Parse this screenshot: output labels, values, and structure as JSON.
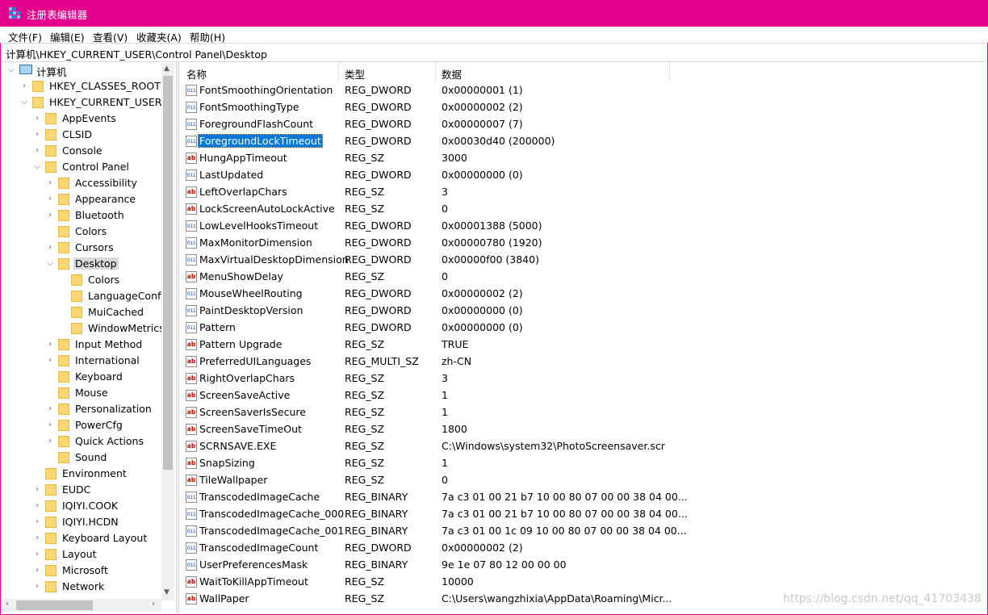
{
  "window": {
    "title": "注册表编辑器",
    "accent_color": "#e3008c"
  },
  "menu": [
    "文件(F)",
    "编辑(E)",
    "查看(V)",
    "收藏夹(A)",
    "帮助(H)"
  ],
  "address": "计算机\\HKEY_CURRENT_USER\\Control Panel\\Desktop",
  "tree": [
    {
      "label": "计算机",
      "depth": 0,
      "expanded": true,
      "icon": "computer-icon"
    },
    {
      "label": "HKEY_CLASSES_ROOT",
      "depth": 1,
      "expanded": false
    },
    {
      "label": "HKEY_CURRENT_USER",
      "depth": 1,
      "expanded": true
    },
    {
      "label": "AppEvents",
      "depth": 2,
      "expanded": false
    },
    {
      "label": "CLSID",
      "depth": 2,
      "expanded": false
    },
    {
      "label": "Console",
      "depth": 2,
      "expanded": false
    },
    {
      "label": "Control Panel",
      "depth": 2,
      "expanded": true
    },
    {
      "label": "Accessibility",
      "depth": 3,
      "expanded": false
    },
    {
      "label": "Appearance",
      "depth": 3,
      "expanded": false
    },
    {
      "label": "Bluetooth",
      "depth": 3,
      "expanded": false
    },
    {
      "label": "Colors",
      "depth": 3,
      "leaf": true
    },
    {
      "label": "Cursors",
      "depth": 3,
      "expanded": false
    },
    {
      "label": "Desktop",
      "depth": 3,
      "expanded": true,
      "selected": true
    },
    {
      "label": "Colors",
      "depth": 4,
      "leaf": true
    },
    {
      "label": "LanguageConfig",
      "depth": 4,
      "leaf": true
    },
    {
      "label": "MuiCached",
      "depth": 4,
      "leaf": true
    },
    {
      "label": "WindowMetrics",
      "depth": 4,
      "leaf": true
    },
    {
      "label": "Input Method",
      "depth": 3,
      "expanded": false
    },
    {
      "label": "International",
      "depth": 3,
      "expanded": false
    },
    {
      "label": "Keyboard",
      "depth": 3,
      "leaf": true
    },
    {
      "label": "Mouse",
      "depth": 3,
      "leaf": true
    },
    {
      "label": "Personalization",
      "depth": 3,
      "expanded": false
    },
    {
      "label": "PowerCfg",
      "depth": 3,
      "expanded": false
    },
    {
      "label": "Quick Actions",
      "depth": 3,
      "expanded": false
    },
    {
      "label": "Sound",
      "depth": 3,
      "leaf": true
    },
    {
      "label": "Environment",
      "depth": 2,
      "leaf": true
    },
    {
      "label": "EUDC",
      "depth": 2,
      "expanded": false
    },
    {
      "label": "IQIYI.COOK",
      "depth": 2,
      "expanded": false
    },
    {
      "label": "IQIYI.HCDN",
      "depth": 2,
      "expanded": false
    },
    {
      "label": "Keyboard Layout",
      "depth": 2,
      "expanded": false
    },
    {
      "label": "Layout",
      "depth": 2,
      "expanded": false
    },
    {
      "label": "Microsoft",
      "depth": 2,
      "expanded": false
    },
    {
      "label": "Network",
      "depth": 2,
      "expanded": false
    }
  ],
  "columns": [
    "名称",
    "类型",
    "数据"
  ],
  "values": [
    {
      "name": "FontSmoothingOrientation",
      "type": "REG_DWORD",
      "data": "0x00000001 (1)"
    },
    {
      "name": "FontSmoothingType",
      "type": "REG_DWORD",
      "data": "0x00000002 (2)"
    },
    {
      "name": "ForegroundFlashCount",
      "type": "REG_DWORD",
      "data": "0x00000007 (7)"
    },
    {
      "name": "ForegroundLockTimeout",
      "type": "REG_DWORD",
      "data": "0x00030d40 (200000)",
      "selected": true
    },
    {
      "name": "HungAppTimeout",
      "type": "REG_SZ",
      "data": "3000"
    },
    {
      "name": "LastUpdated",
      "type": "REG_DWORD",
      "data": "0x00000000 (0)"
    },
    {
      "name": "LeftOverlapChars",
      "type": "REG_SZ",
      "data": "3"
    },
    {
      "name": "LockScreenAutoLockActive",
      "type": "REG_SZ",
      "data": "0"
    },
    {
      "name": "LowLevelHooksTimeout",
      "type": "REG_DWORD",
      "data": "0x00001388 (5000)"
    },
    {
      "name": "MaxMonitorDimension",
      "type": "REG_DWORD",
      "data": "0x00000780 (1920)"
    },
    {
      "name": "MaxVirtualDesktopDimension",
      "type": "REG_DWORD",
      "data": "0x00000f00 (3840)"
    },
    {
      "name": "MenuShowDelay",
      "type": "REG_SZ",
      "data": "0"
    },
    {
      "name": "MouseWheelRouting",
      "type": "REG_DWORD",
      "data": "0x00000002 (2)"
    },
    {
      "name": "PaintDesktopVersion",
      "type": "REG_DWORD",
      "data": "0x00000000 (0)"
    },
    {
      "name": "Pattern",
      "type": "REG_DWORD",
      "data": "0x00000000 (0)"
    },
    {
      "name": "Pattern Upgrade",
      "type": "REG_SZ",
      "data": "TRUE"
    },
    {
      "name": "PreferredUILanguages",
      "type": "REG_MULTI_SZ",
      "data": "zh-CN"
    },
    {
      "name": "RightOverlapChars",
      "type": "REG_SZ",
      "data": "3"
    },
    {
      "name": "ScreenSaveActive",
      "type": "REG_SZ",
      "data": "1"
    },
    {
      "name": "ScreenSaverIsSecure",
      "type": "REG_SZ",
      "data": "1"
    },
    {
      "name": "ScreenSaveTimeOut",
      "type": "REG_SZ",
      "data": "1800"
    },
    {
      "name": "SCRNSAVE.EXE",
      "type": "REG_SZ",
      "data": "C:\\Windows\\system32\\PhotoScreensaver.scr"
    },
    {
      "name": "SnapSizing",
      "type": "REG_SZ",
      "data": "1"
    },
    {
      "name": "TileWallpaper",
      "type": "REG_SZ",
      "data": "0"
    },
    {
      "name": "TranscodedImageCache",
      "type": "REG_BINARY",
      "data": "7a c3 01 00 21 b7 10 00 80 07 00 00 38 04 00..."
    },
    {
      "name": "TranscodedImageCache_000",
      "type": "REG_BINARY",
      "data": "7a c3 01 00 21 b7 10 00 80 07 00 00 38 04 00..."
    },
    {
      "name": "TranscodedImageCache_001",
      "type": "REG_BINARY",
      "data": "7a c3 01 00 1c 09 10 00 80 07 00 00 38 04 00..."
    },
    {
      "name": "TranscodedImageCount",
      "type": "REG_DWORD",
      "data": "0x00000002 (2)"
    },
    {
      "name": "UserPreferencesMask",
      "type": "REG_BINARY",
      "data": "9e 1e 07 80 12 00 00 00"
    },
    {
      "name": "WaitToKillAppTimeout",
      "type": "REG_SZ",
      "data": "10000"
    },
    {
      "name": "WallPaper",
      "type": "REG_SZ",
      "data": "C:\\Users\\wangzhixia\\AppData\\Roaming\\Micr..."
    }
  ],
  "watermark": "https://blog.csdn.net/qq_41703438"
}
